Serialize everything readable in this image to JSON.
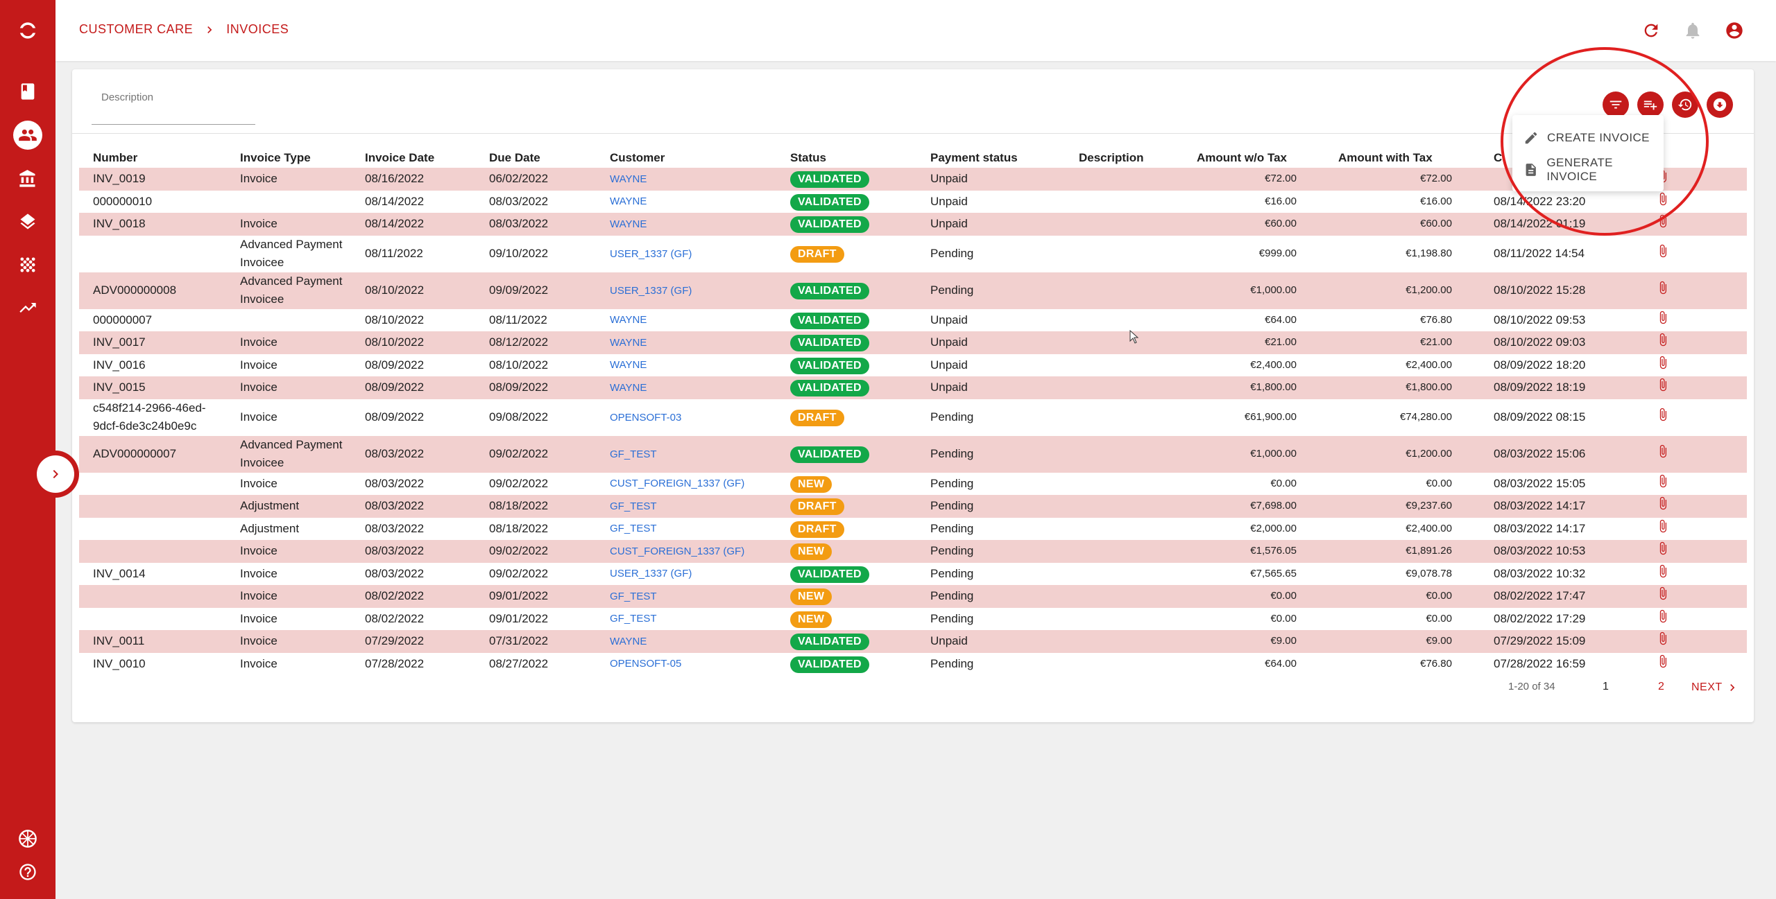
{
  "breadcrumb": {
    "parent": "CUSTOMER CARE",
    "current": "INVOICES"
  },
  "sidebar": {
    "items": [
      "book-icon",
      "customers-icon",
      "bank-icon",
      "layers-icon",
      "scatter-icon",
      "trending-up-icon"
    ],
    "bottom": [
      "language-flag-icon",
      "help-icon"
    ]
  },
  "filter": {
    "description_label": "Description",
    "description_value": ""
  },
  "menu": {
    "create_invoice": "CREATE INVOICE",
    "generate_invoice": "GENERATE INVOICE"
  },
  "table": {
    "headers": {
      "number": "Number",
      "type": "Invoice Type",
      "invoice_date": "Invoice Date",
      "due_date": "Due Date",
      "customer": "Customer",
      "status": "Status",
      "payment_status": "Payment status",
      "description": "Description",
      "amount_wo_tax": "Amount w/o Tax",
      "amount_with_tax": "Amount with Tax",
      "created": "C"
    },
    "rows": [
      {
        "number": "INV_0019",
        "type": "Invoice",
        "invoice_date": "08/16/2022",
        "due_date": "06/02/2022",
        "customer": "WAYNE",
        "status": "VALIDATED",
        "payment": "Unpaid",
        "amount_wo": "€72.00",
        "amount_with": "€72.00",
        "created": ""
      },
      {
        "number": "000000010",
        "type": "",
        "invoice_date": "08/14/2022",
        "due_date": "08/03/2022",
        "customer": "WAYNE",
        "status": "VALIDATED",
        "payment": "Unpaid",
        "amount_wo": "€16.00",
        "amount_with": "€16.00",
        "created": "08/14/2022 23:20"
      },
      {
        "number": "INV_0018",
        "type": "Invoice",
        "invoice_date": "08/14/2022",
        "due_date": "08/03/2022",
        "customer": "WAYNE",
        "status": "VALIDATED",
        "payment": "Unpaid",
        "amount_wo": "€60.00",
        "amount_with": "€60.00",
        "created": "08/14/2022 01:19"
      },
      {
        "number": "",
        "type": "Advanced Payment Invoicee",
        "invoice_date": "08/11/2022",
        "due_date": "09/10/2022",
        "customer": "USER_1337 (GF)",
        "status": "DRAFT",
        "payment": "Pending",
        "amount_wo": "€999.00",
        "amount_with": "€1,198.80",
        "created": "08/11/2022 14:54"
      },
      {
        "number": "ADV000000008",
        "type": "Advanced Payment Invoicee",
        "invoice_date": "08/10/2022",
        "due_date": "09/09/2022",
        "customer": "USER_1337 (GF)",
        "status": "VALIDATED",
        "payment": "Pending",
        "amount_wo": "€1,000.00",
        "amount_with": "€1,200.00",
        "created": "08/10/2022 15:28"
      },
      {
        "number": "000000007",
        "type": "",
        "invoice_date": "08/10/2022",
        "due_date": "08/11/2022",
        "customer": "WAYNE",
        "status": "VALIDATED",
        "payment": "Unpaid",
        "amount_wo": "€64.00",
        "amount_with": "€76.80",
        "created": "08/10/2022 09:53"
      },
      {
        "number": "INV_0017",
        "type": "Invoice",
        "invoice_date": "08/10/2022",
        "due_date": "08/12/2022",
        "customer": "WAYNE",
        "status": "VALIDATED",
        "payment": "Unpaid",
        "amount_wo": "€21.00",
        "amount_with": "€21.00",
        "created": "08/10/2022 09:03"
      },
      {
        "number": "INV_0016",
        "type": "Invoice",
        "invoice_date": "08/09/2022",
        "due_date": "08/10/2022",
        "customer": "WAYNE",
        "status": "VALIDATED",
        "payment": "Unpaid",
        "amount_wo": "€2,400.00",
        "amount_with": "€2,400.00",
        "created": "08/09/2022 18:20"
      },
      {
        "number": "INV_0015",
        "type": "Invoice",
        "invoice_date": "08/09/2022",
        "due_date": "08/09/2022",
        "customer": "WAYNE",
        "status": "VALIDATED",
        "payment": "Unpaid",
        "amount_wo": "€1,800.00",
        "amount_with": "€1,800.00",
        "created": "08/09/2022 18:19"
      },
      {
        "number": "c548f214-2966-46ed-9dcf-6de3c24b0e9c",
        "type": "Invoice",
        "invoice_date": "08/09/2022",
        "due_date": "09/08/2022",
        "customer": "OPENSOFT-03",
        "status": "DRAFT",
        "payment": "Pending",
        "amount_wo": "€61,900.00",
        "amount_with": "€74,280.00",
        "created": "08/09/2022 08:15"
      },
      {
        "number": "ADV000000007",
        "type": "Advanced Payment Invoicee",
        "invoice_date": "08/03/2022",
        "due_date": "09/02/2022",
        "customer": "GF_TEST",
        "status": "VALIDATED",
        "payment": "Pending",
        "amount_wo": "€1,000.00",
        "amount_with": "€1,200.00",
        "created": "08/03/2022 15:06"
      },
      {
        "number": "",
        "type": "Invoice",
        "invoice_date": "08/03/2022",
        "due_date": "09/02/2022",
        "customer": "CUST_FOREIGN_1337 (GF)",
        "status": "NEW",
        "payment": "Pending",
        "amount_wo": "€0.00",
        "amount_with": "€0.00",
        "created": "08/03/2022 15:05"
      },
      {
        "number": "",
        "type": "Adjustment",
        "invoice_date": "08/03/2022",
        "due_date": "08/18/2022",
        "customer": "GF_TEST",
        "status": "DRAFT",
        "payment": "Pending",
        "amount_wo": "€7,698.00",
        "amount_with": "€9,237.60",
        "created": "08/03/2022 14:17"
      },
      {
        "number": "",
        "type": "Adjustment",
        "invoice_date": "08/03/2022",
        "due_date": "08/18/2022",
        "customer": "GF_TEST",
        "status": "DRAFT",
        "payment": "Pending",
        "amount_wo": "€2,000.00",
        "amount_with": "€2,400.00",
        "created": "08/03/2022 14:17"
      },
      {
        "number": "",
        "type": "Invoice",
        "invoice_date": "08/03/2022",
        "due_date": "09/02/2022",
        "customer": "CUST_FOREIGN_1337 (GF)",
        "status": "NEW",
        "payment": "Pending",
        "amount_wo": "€1,576.05",
        "amount_with": "€1,891.26",
        "created": "08/03/2022 10:53"
      },
      {
        "number": "INV_0014",
        "type": "Invoice",
        "invoice_date": "08/03/2022",
        "due_date": "09/02/2022",
        "customer": "USER_1337 (GF)",
        "status": "VALIDATED",
        "payment": "Pending",
        "amount_wo": "€7,565.65",
        "amount_with": "€9,078.78",
        "created": "08/03/2022 10:32"
      },
      {
        "number": "",
        "type": "Invoice",
        "invoice_date": "08/02/2022",
        "due_date": "09/01/2022",
        "customer": "GF_TEST",
        "status": "NEW",
        "payment": "Pending",
        "amount_wo": "€0.00",
        "amount_with": "€0.00",
        "created": "08/02/2022 17:47"
      },
      {
        "number": "",
        "type": "Invoice",
        "invoice_date": "08/02/2022",
        "due_date": "09/01/2022",
        "customer": "GF_TEST",
        "status": "NEW",
        "payment": "Pending",
        "amount_wo": "€0.00",
        "amount_with": "€0.00",
        "created": "08/02/2022 17:29"
      },
      {
        "number": "INV_0011",
        "type": "Invoice",
        "invoice_date": "07/29/2022",
        "due_date": "07/31/2022",
        "customer": "WAYNE",
        "status": "VALIDATED",
        "payment": "Unpaid",
        "amount_wo": "€9.00",
        "amount_with": "€9.00",
        "created": "07/29/2022 15:09"
      },
      {
        "number": "INV_0010",
        "type": "Invoice",
        "invoice_date": "07/28/2022",
        "due_date": "08/27/2022",
        "customer": "OPENSOFT-05",
        "status": "VALIDATED",
        "payment": "Pending",
        "amount_wo": "€64.00",
        "amount_with": "€76.80",
        "created": "07/28/2022 16:59"
      }
    ]
  },
  "pagination": {
    "range": "1-20 of 34",
    "page1": "1",
    "page2": "2",
    "next": "NEXT"
  },
  "colors": {
    "brand": "#c41a1a",
    "validated": "#13a849",
    "draft_new": "#f39c12",
    "alt_row": "#f2d0cf",
    "link": "#2b6fd6"
  }
}
